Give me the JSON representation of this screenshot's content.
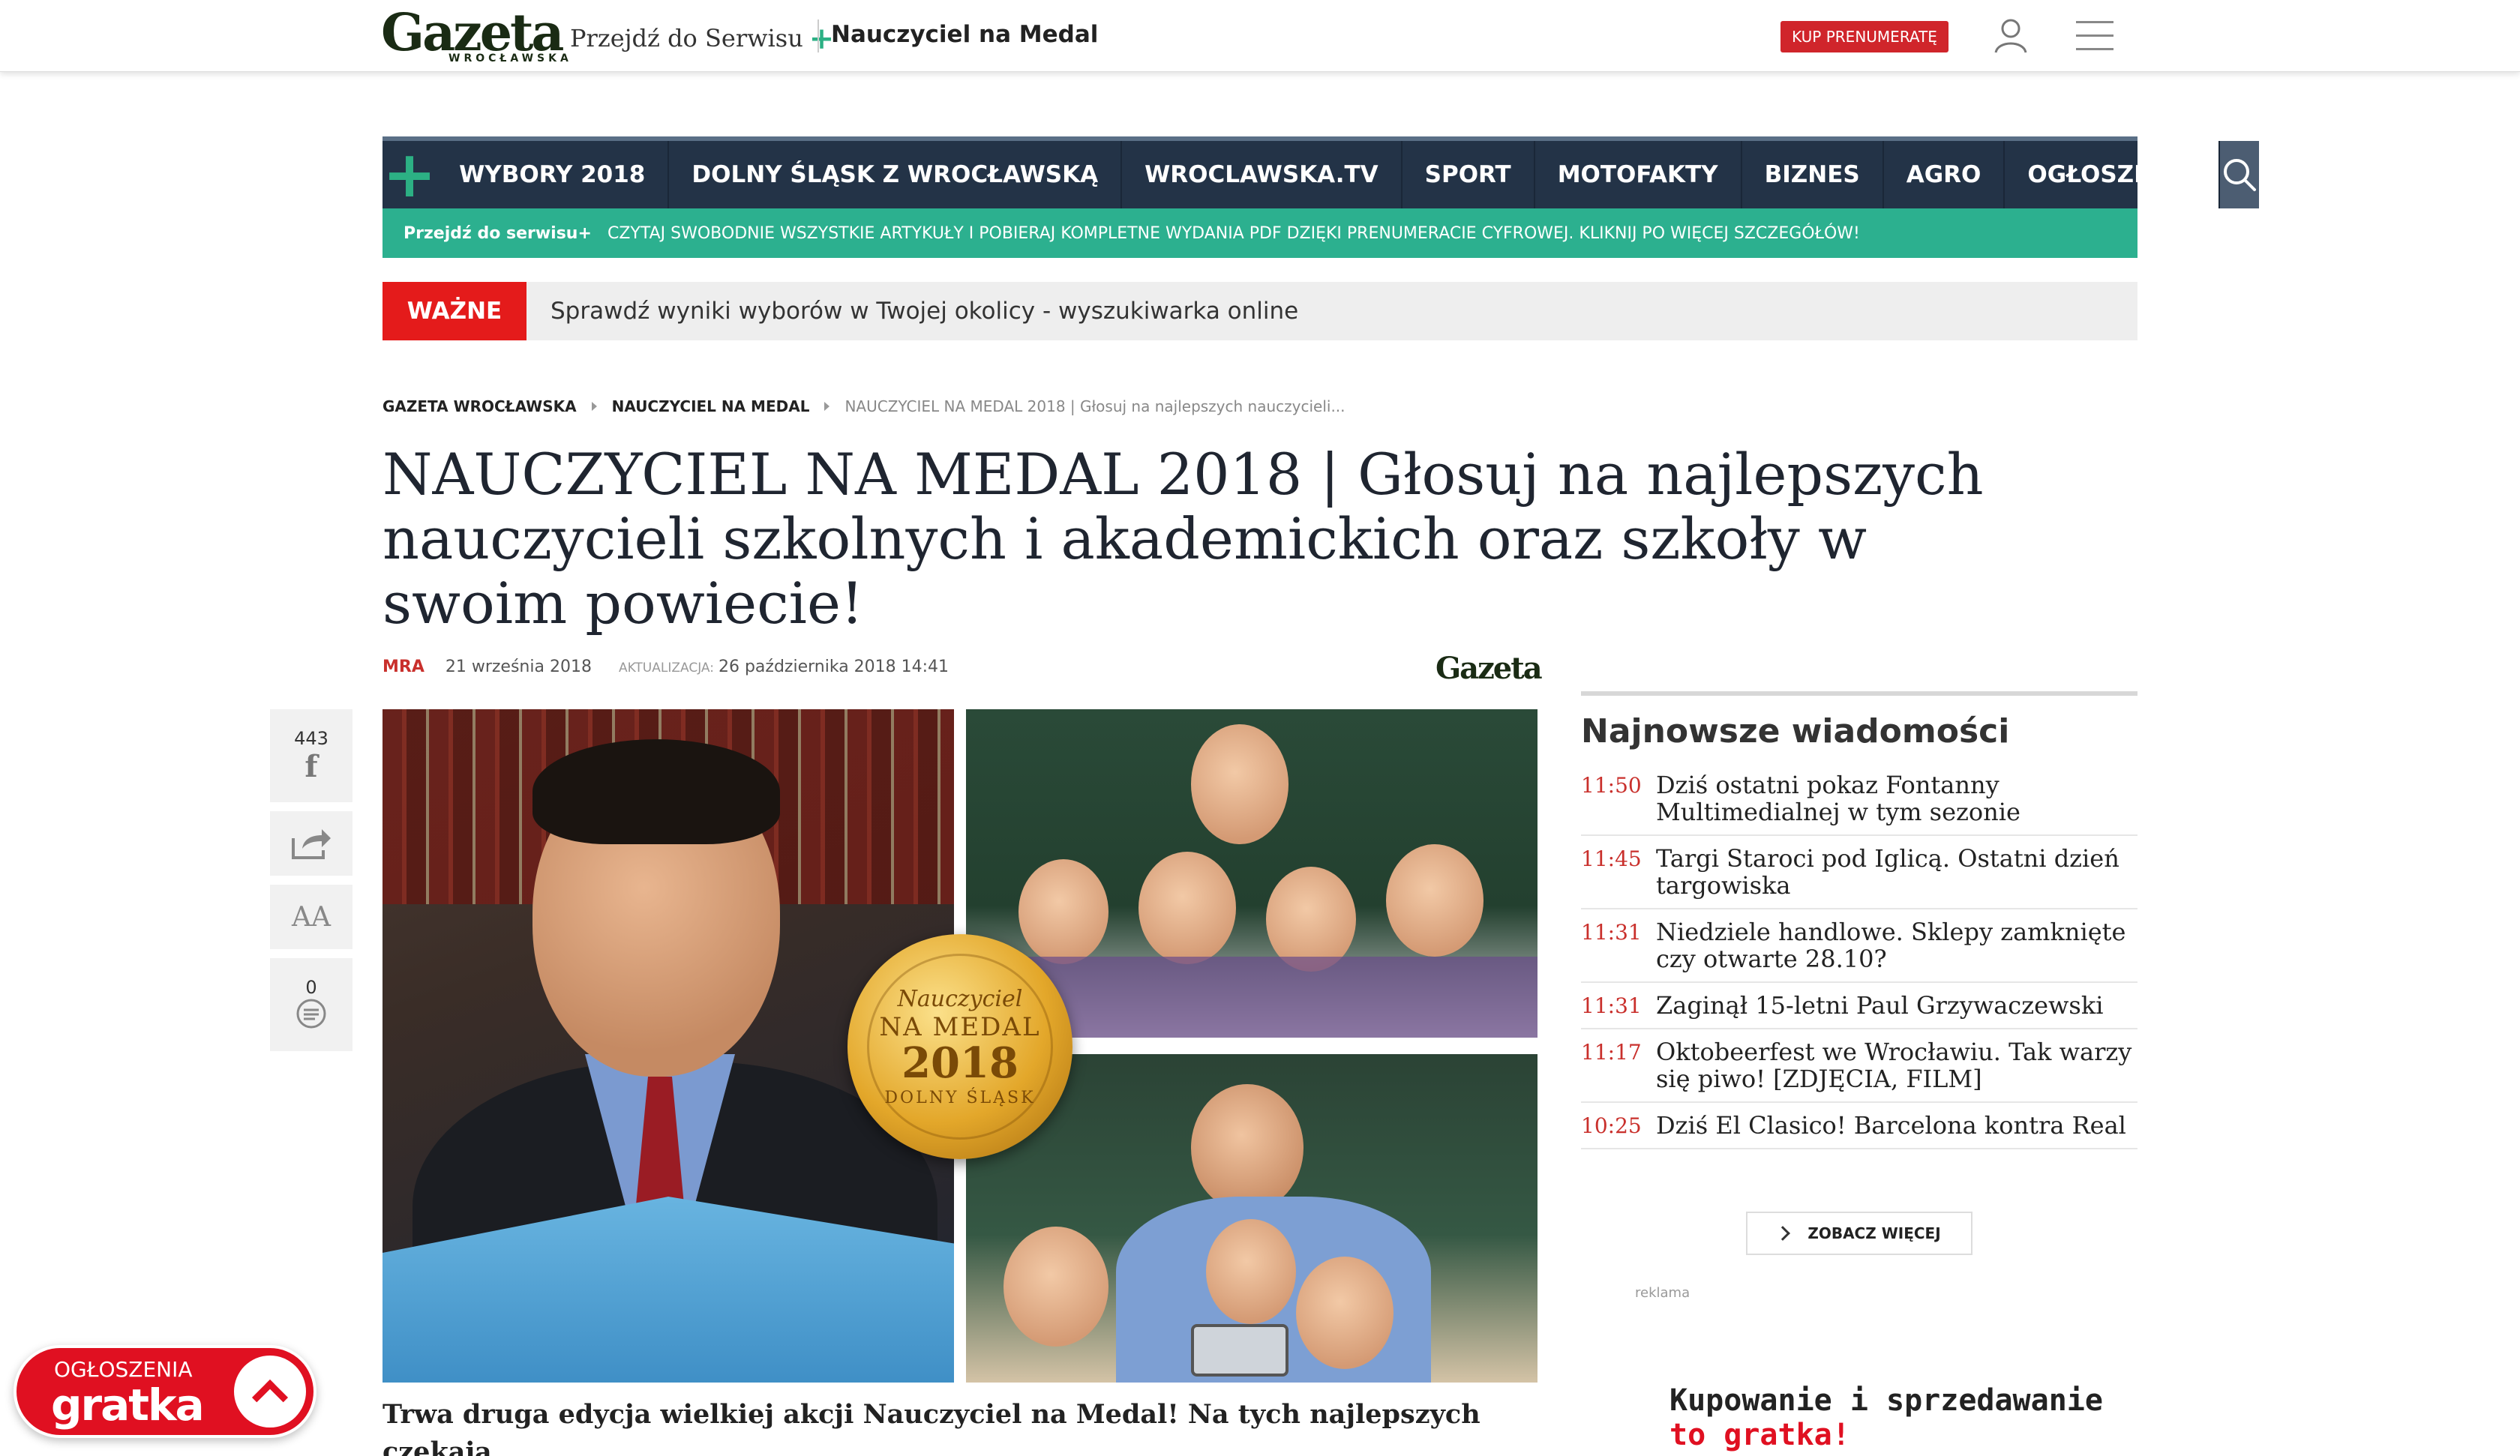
{
  "topbar": {
    "logo_text": "Gazeta",
    "logo_sub": "WROCŁAWSKA",
    "service_link": "Przejdź do Serwisu",
    "plus": "+",
    "section_title": "Nauczyciel na Medal",
    "subscribe_label": "KUP PRENUMERATĘ"
  },
  "nav": {
    "plus": "+",
    "items": [
      "WYBORY 2018",
      "DOLNY ŚLĄSK Z WROCŁAWSKĄ",
      "WROCLAWSKA.TV",
      "SPORT",
      "MOTOFAKTY",
      "BIZNES",
      "AGRO",
      "OGŁOSZENIA"
    ]
  },
  "promo": {
    "left": "Przejdź do serwisu+",
    "text": "CZYTAJ SWOBODNIE WSZYSTKIE ARTYKUŁY I POBIERAJ KOMPLETNE WYDANIA PDF DZIĘKI PRENUMERACIE CYFROWEJ. KLIKNIJ PO WIĘCEJ SZCZEGÓŁÓW!"
  },
  "important": {
    "badge": "WAŻNE",
    "text": "Sprawdź wyniki wyborów w Twojej okolicy - wyszukiwarka online"
  },
  "breadcrumb": [
    "GAZETA WROCŁAWSKA",
    "NAUCZYCIEL NA MEDAL",
    "NAUCZYCIEL NA MEDAL 2018 | Głosuj na najlepszych nauczycieli..."
  ],
  "article": {
    "title": "NAUCZYCIEL NA MEDAL 2018 | Głosuj na najlepszych nauczycieli szkolnych i akademickich oraz szkoły w swoim powiecie!",
    "author": "MRA",
    "date": "21 września 2018",
    "update_label": "AKTUALIZACJA:",
    "update_date": "26 października 2018 14:41",
    "meta_logo": "Gazeta",
    "lead": "Trwa druga edycja wielkiej akcji Nauczyciel na Medal! Na tych najlepszych czekają"
  },
  "medal": {
    "line1": "Nauczyciel",
    "line2": "NA MEDAL",
    "line3": "2018",
    "line4": "DOLNY ŚLĄSK"
  },
  "share": {
    "fb_count": "443",
    "fb_icon": "f",
    "font_icon": "AA",
    "comments_count": "0"
  },
  "sidebar": {
    "heading": "Najnowsze wiadomości",
    "news": [
      {
        "time": "11:50",
        "title": "Dziś ostatni pokaz Fontanny Multimedialnej w tym sezonie"
      },
      {
        "time": "11:45",
        "title": "Targi Staroci pod Iglicą. Ostatni dzień targowiska"
      },
      {
        "time": "11:31",
        "title": "Niedziele handlowe. Sklepy zamknięte czy otwarte 28.10?"
      },
      {
        "time": "11:31",
        "title": "Zaginął 15-letni Paul Grzywaczewski"
      },
      {
        "time": "11:17",
        "title": "Oktobeerfest we Wrocławiu. Tak warzy się piwo! [ZDJĘCIA, FILM]"
      },
      {
        "time": "10:25",
        "title": "Dziś El Clasico! Barcelona kontra Real"
      }
    ],
    "more_label": "ZOBACZ WIĘCEJ",
    "ad_label": "reklama",
    "ad_line1": "Kupowanie i sprzedawanie",
    "ad_line2": "to gratka!"
  },
  "gratka": {
    "label": "OGŁOSZENIA",
    "brand": "gratka"
  },
  "colors": {
    "nav_bg": "#233347",
    "teal": "#2cb08f",
    "red": "#e41b1b",
    "accent_time": "#c9302c"
  }
}
